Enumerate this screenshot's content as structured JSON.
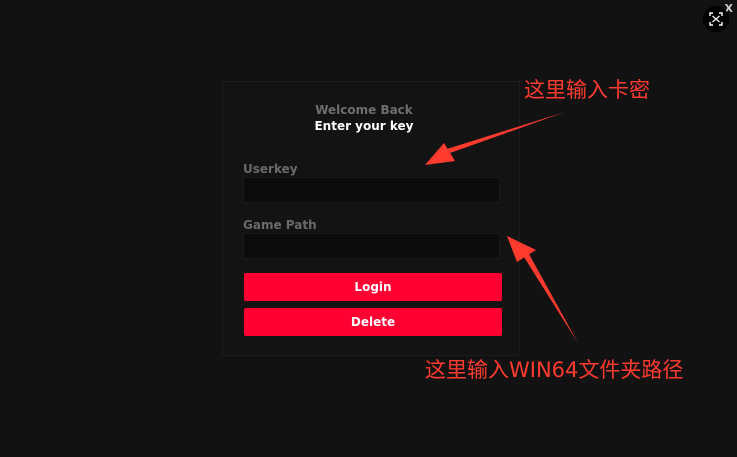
{
  "window": {
    "close_label": "X"
  },
  "login": {
    "welcome": "Welcome Back",
    "subtitle": "Enter your key",
    "userkey_label": "Userkey",
    "userkey_value": "",
    "gamepath_label": "Game Path",
    "gamepath_value": "",
    "login_button": "Login",
    "delete_button": "Delete"
  },
  "annotations": {
    "key_hint": "这里输入卡密",
    "path_hint": "这里输入WIN64文件夹路径"
  },
  "colors": {
    "background": "#121212",
    "accent": "#ff0033",
    "annotation": "#ff3b30"
  },
  "icons": {
    "screenshot": "screenshot-scan-icon"
  }
}
